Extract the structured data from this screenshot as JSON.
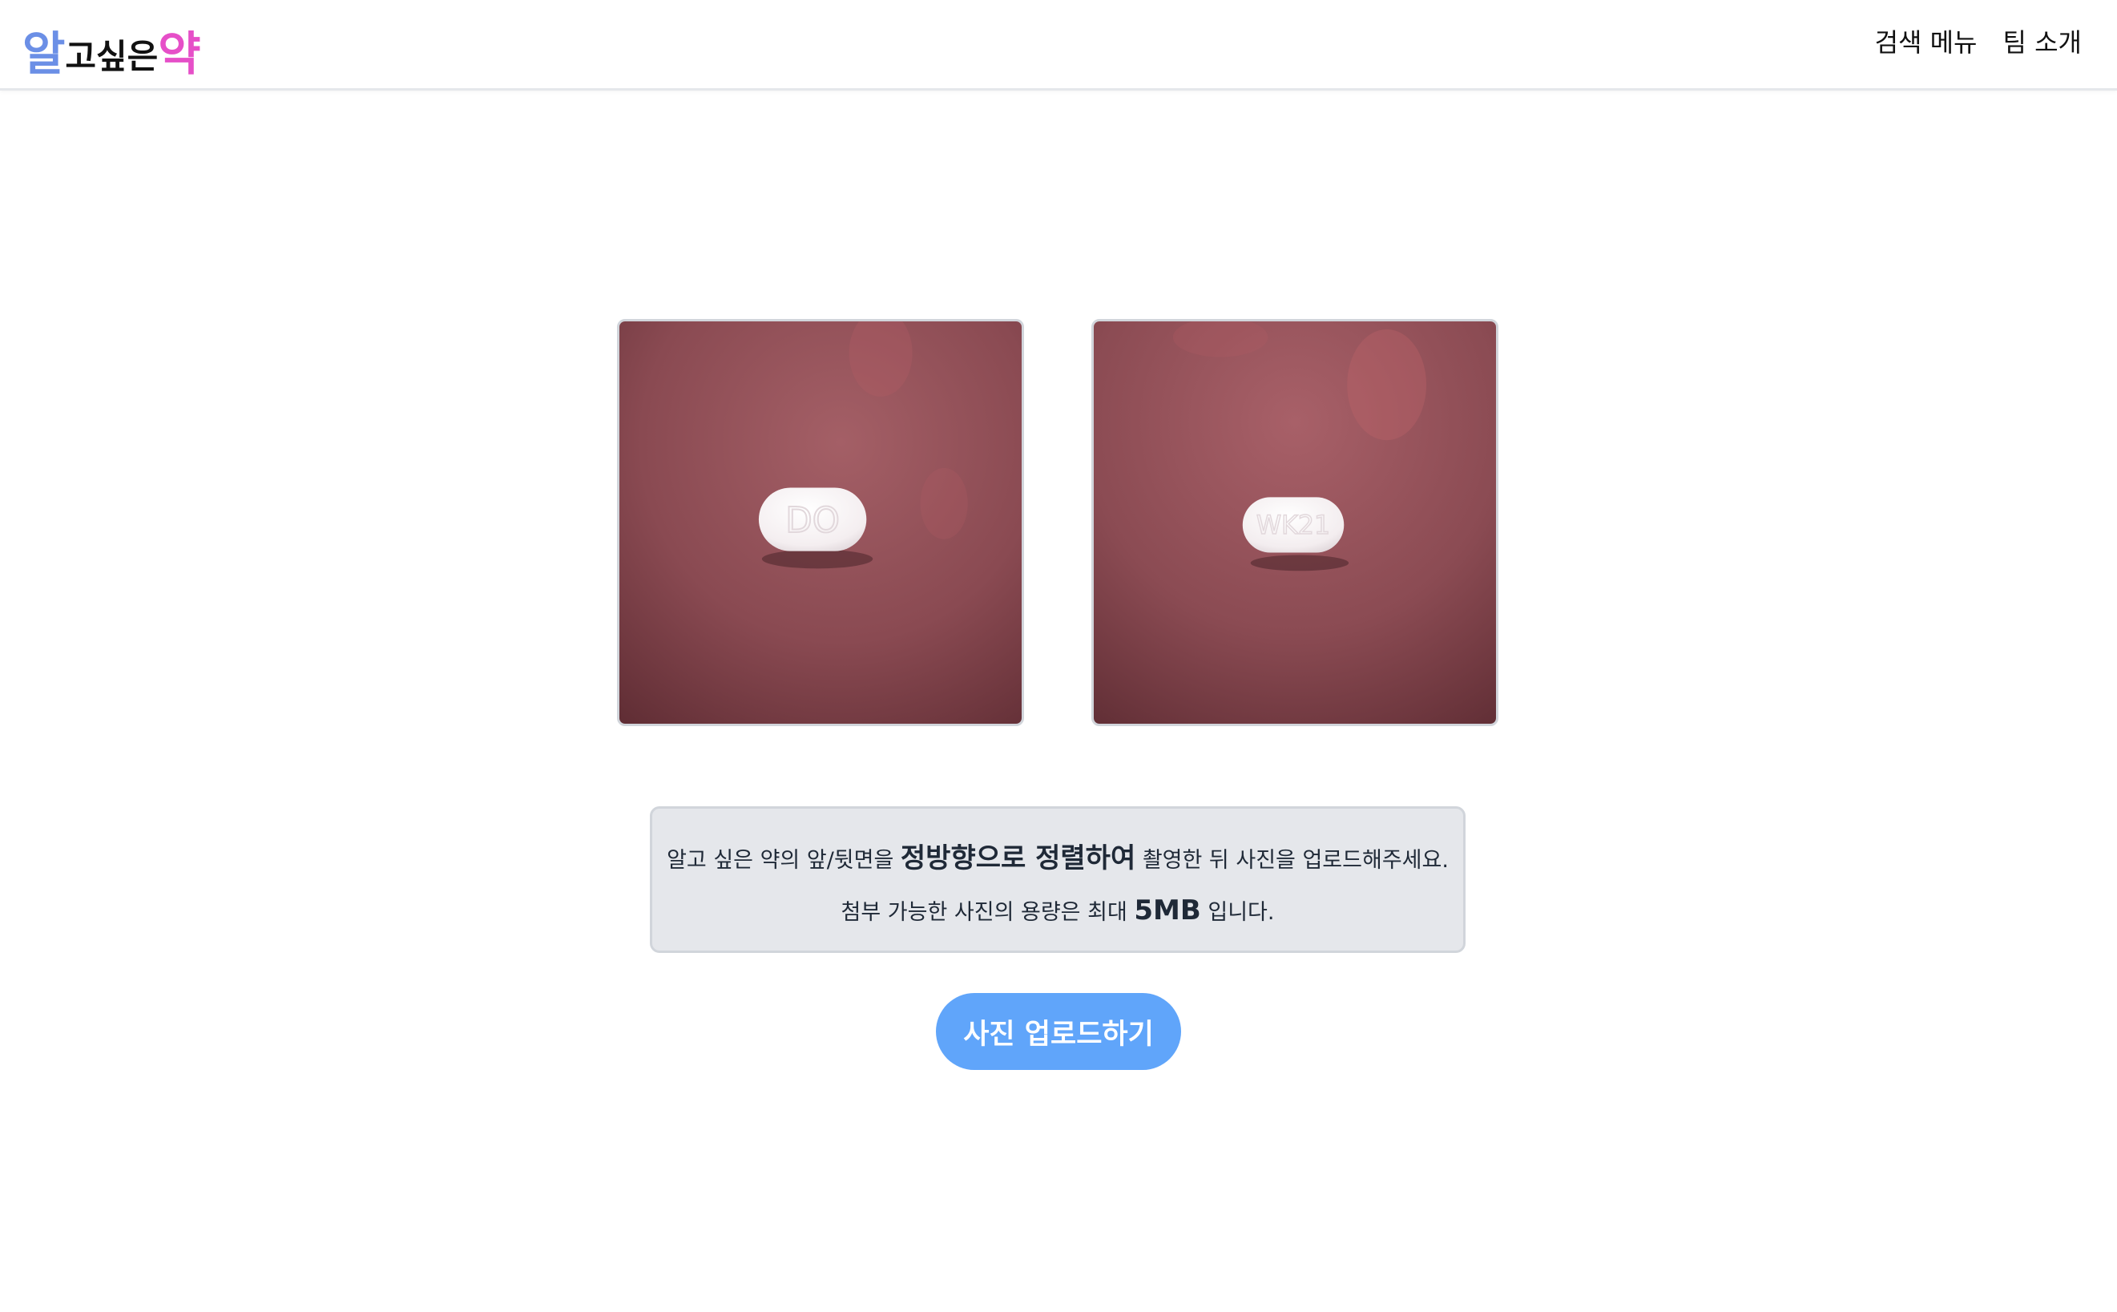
{
  "header": {
    "logo": {
      "part1": "알",
      "part2": "고싶은",
      "part3": "약"
    },
    "nav": [
      {
        "label": "검색 메뉴"
      },
      {
        "label": "팀 소개"
      }
    ]
  },
  "photos": {
    "front": {
      "imprint": "DO",
      "icon": "pill-photo-front"
    },
    "back": {
      "imprint": "WK21",
      "icon": "pill-photo-back"
    }
  },
  "notice": {
    "line1_pre": "알고 싶은 약의 앞/뒷면을 ",
    "line1_emph": "정방향으로 정렬하여",
    "line1_post": " 촬영한 뒤 사진을 업로드해주세요.",
    "line2_pre": "첨부 가능한 사진의 용량은 최대 ",
    "line2_emph": "5MB",
    "line2_post": " 입니다."
  },
  "upload_button": {
    "label": "사진 업로드하기"
  },
  "colors": {
    "logo_blue": "#6b8fe6",
    "logo_pink": "#e64fc8",
    "button": "#60a5fa",
    "notice_bg": "#e5e7eb"
  }
}
